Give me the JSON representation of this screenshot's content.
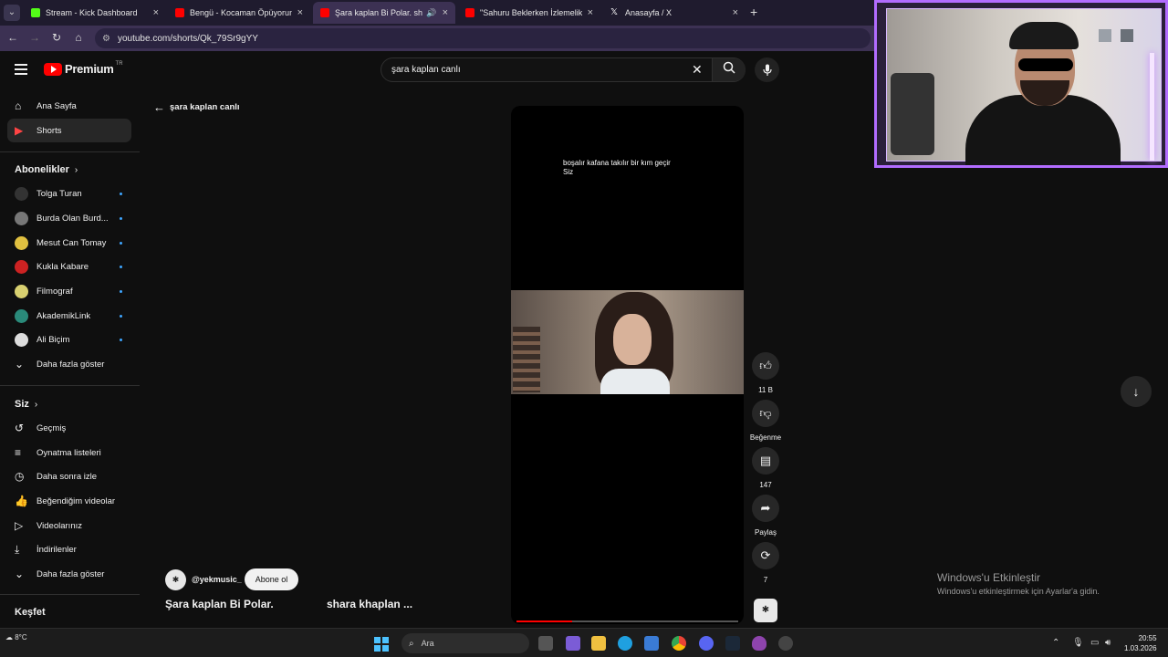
{
  "browser": {
    "tabs": [
      {
        "title": "Stream - Kick Dashboard",
        "favicon_color": "#53fc18",
        "active": false
      },
      {
        "title": "Bengü - Kocaman Öpüyorum -",
        "favicon_color": "#ff0000",
        "active": false
      },
      {
        "title": "Şara kaplan Bi Polar. shara",
        "favicon_color": "#ff0000",
        "active": true
      },
      {
        "title": "\"Sahuru Beklerken İzlemelik Ed",
        "favicon_color": "#ff0000",
        "active": false
      },
      {
        "title": "Anasayfa / X",
        "favicon_color": "#ffffff",
        "active": false
      }
    ],
    "new_tab": "+",
    "url": "youtube.com/shorts/Qk_79Sr9gYY"
  },
  "header": {
    "logo_text": "Premium",
    "logo_country": "TR",
    "search_value": "şara kaplan canlı"
  },
  "sidebar": {
    "main": [
      {
        "label": "Ana Sayfa",
        "icon": "home-icon",
        "glyph": "⌂"
      },
      {
        "label": "Shorts",
        "icon": "shorts-icon",
        "glyph": "▶"
      }
    ],
    "subscriptions_title": "Abonelikler",
    "subscriptions": [
      {
        "label": "Tolga Turan",
        "color": "#333333"
      },
      {
        "label": "Burda Olan Burd...",
        "color": "#777777"
      },
      {
        "label": "Mesut Can Tomay",
        "color": "#e0c040"
      },
      {
        "label": "Kukla Kabare",
        "color": "#cc2222"
      },
      {
        "label": "Filmograf",
        "color": "#d8d070"
      },
      {
        "label": "AkademikLink",
        "color": "#2a8a7a"
      },
      {
        "label": "Ali Biçim",
        "color": "#dddddd"
      }
    ],
    "show_more_1": "Daha fazla göster",
    "you_title": "Siz",
    "you": [
      {
        "label": "Geçmiş",
        "icon": "history-icon",
        "glyph": "↺"
      },
      {
        "label": "Oynatma listeleri",
        "icon": "playlist-icon",
        "glyph": "≡"
      },
      {
        "label": "Daha sonra izle",
        "icon": "clock-icon",
        "glyph": "◷"
      },
      {
        "label": "Beğendiğim videolar",
        "icon": "thumb-up-icon",
        "glyph": "👍"
      },
      {
        "label": "Videolarınız",
        "icon": "video-icon",
        "glyph": "▷"
      },
      {
        "label": "İndirilenler",
        "icon": "download-icon",
        "glyph": "⤓"
      }
    ],
    "show_more_2": "Daha fazla göster",
    "explore_title": "Keşfet"
  },
  "main": {
    "back_query": "şara kaplan canlı",
    "caption_line1": "boşalır kafana takılır bir kım geçir",
    "caption_line2": "Siz",
    "progress_fraction": 0.25,
    "actions": {
      "like_count": "11 B",
      "dislike_label": "Beğenme",
      "comment_count": "147",
      "share_label": "Paylaş",
      "remix_count": "7"
    },
    "channel_handle": "@yekmusic_",
    "subscribe_label": "Abone ol",
    "title": "Şara kaplan Bi Polar.",
    "title2": "shara khaplan ..."
  },
  "watermark": {
    "line1": "Windows'u Etkinleştir",
    "line2": "Windows'u etkinleştirmek için Ayarlar'a gidin."
  },
  "taskbar": {
    "temperature": "8°C",
    "search_placeholder": "Ara",
    "time": "20:55",
    "date": "1.03.2026"
  }
}
